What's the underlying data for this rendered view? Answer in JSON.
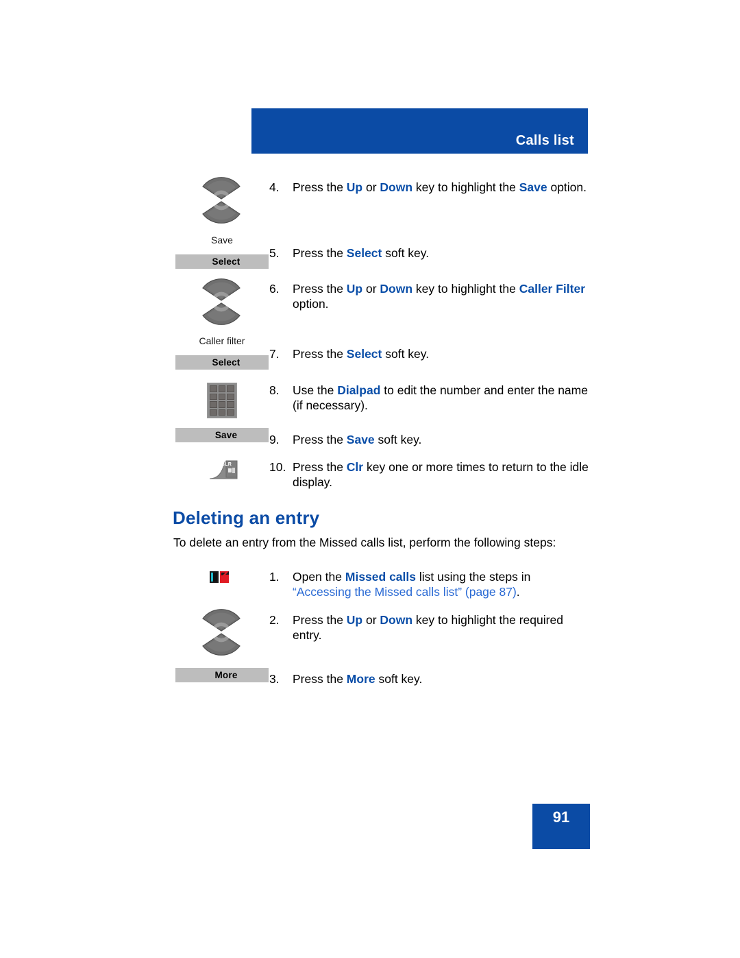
{
  "header": {
    "title": "Calls list"
  },
  "colors": {
    "brand_blue": "#0b4ba5",
    "key_blue": "#0a4ea8",
    "link_blue": "#2a6ad4",
    "softkey_gray": "#bdbdbd"
  },
  "margin_items": {
    "save_nav_label": "Save",
    "caller_filter_nav_label": "Caller filter",
    "softkey_select_1": "Select",
    "softkey_select_2": "Select",
    "softkey_save": "Save",
    "softkey_more": "More",
    "clr_key_text": "CLR"
  },
  "steps_top": [
    {
      "number": "4.",
      "segments": [
        {
          "t": "Press the ",
          "style": "plain"
        },
        {
          "t": "Up",
          "style": "key"
        },
        {
          "t": " or ",
          "style": "plain"
        },
        {
          "t": "Down",
          "style": "key"
        },
        {
          "t": " key to highlight the ",
          "style": "plain"
        },
        {
          "t": "Save",
          "style": "key"
        },
        {
          "t": " option.",
          "style": "plain"
        }
      ],
      "plain_text": "Press the Up or Down key to highlight the Save option."
    },
    {
      "number": "5.",
      "segments": [
        {
          "t": "Press the ",
          "style": "plain"
        },
        {
          "t": "Select",
          "style": "key"
        },
        {
          "t": " soft key.",
          "style": "plain"
        }
      ],
      "plain_text": "Press the Select soft key."
    },
    {
      "number": "6.",
      "segments": [
        {
          "t": "Press the ",
          "style": "plain"
        },
        {
          "t": "Up",
          "style": "key"
        },
        {
          "t": " or ",
          "style": "plain"
        },
        {
          "t": "Down",
          "style": "key"
        },
        {
          "t": " key to highlight the ",
          "style": "plain"
        },
        {
          "t": "Caller Filter",
          "style": "key"
        },
        {
          "t": " option.",
          "style": "plain"
        }
      ],
      "plain_text": "Press the Up or Down key to highlight the Caller Filter option."
    },
    {
      "number": "7.",
      "segments": [
        {
          "t": "Press the ",
          "style": "plain"
        },
        {
          "t": "Select",
          "style": "key"
        },
        {
          "t": " soft key.",
          "style": "plain"
        }
      ],
      "plain_text": "Press the Select soft key."
    },
    {
      "number": "8.",
      "segments": [
        {
          "t": "Use the ",
          "style": "plain"
        },
        {
          "t": "Dialpad",
          "style": "key"
        },
        {
          "t": " to edit the number and enter the name (if necessary).",
          "style": "plain"
        }
      ],
      "plain_text": "Use the Dialpad to edit the number and enter the name (if necessary)."
    },
    {
      "number": "9.",
      "segments": [
        {
          "t": "Press the ",
          "style": "plain"
        },
        {
          "t": "Save",
          "style": "key"
        },
        {
          "t": " soft key.",
          "style": "plain"
        }
      ],
      "plain_text": "Press the Save soft key."
    },
    {
      "number": "10.",
      "segments": [
        {
          "t": "Press the ",
          "style": "plain"
        },
        {
          "t": "Clr",
          "style": "key"
        },
        {
          "t": " key one or more times to return to the idle display.",
          "style": "plain"
        }
      ],
      "plain_text": "Press the Clr key one or more times to return to the idle display."
    }
  ],
  "section": {
    "heading": "Deleting an entry",
    "intro": "To delete an entry from the Missed calls list, perform the following steps:"
  },
  "steps_bottom": [
    {
      "number": "1.",
      "segments": [
        {
          "t": "Open the ",
          "style": "plain"
        },
        {
          "t": "Missed calls",
          "style": "key"
        },
        {
          "t": " list using the steps in ",
          "style": "plain"
        },
        {
          "t": "“Accessing the Missed calls list” (page 87)",
          "style": "xref"
        },
        {
          "t": ".",
          "style": "plain"
        }
      ],
      "plain_text": "Open the Missed calls list using the steps in “Accessing the Missed calls list” (page 87)."
    },
    {
      "number": "2.",
      "segments": [
        {
          "t": "Press the ",
          "style": "plain"
        },
        {
          "t": "Up",
          "style": "key"
        },
        {
          "t": " or ",
          "style": "plain"
        },
        {
          "t": "Down",
          "style": "key"
        },
        {
          "t": " key to highlight the required entry.",
          "style": "plain"
        }
      ],
      "plain_text": "Press the Up or Down key to highlight the required entry."
    },
    {
      "number": "3.",
      "segments": [
        {
          "t": "Press the ",
          "style": "plain"
        },
        {
          "t": "More",
          "style": "key"
        },
        {
          "t": " soft key.",
          "style": "plain"
        }
      ],
      "plain_text": "Press the More soft key."
    }
  ],
  "footer": {
    "page_number": "91"
  }
}
